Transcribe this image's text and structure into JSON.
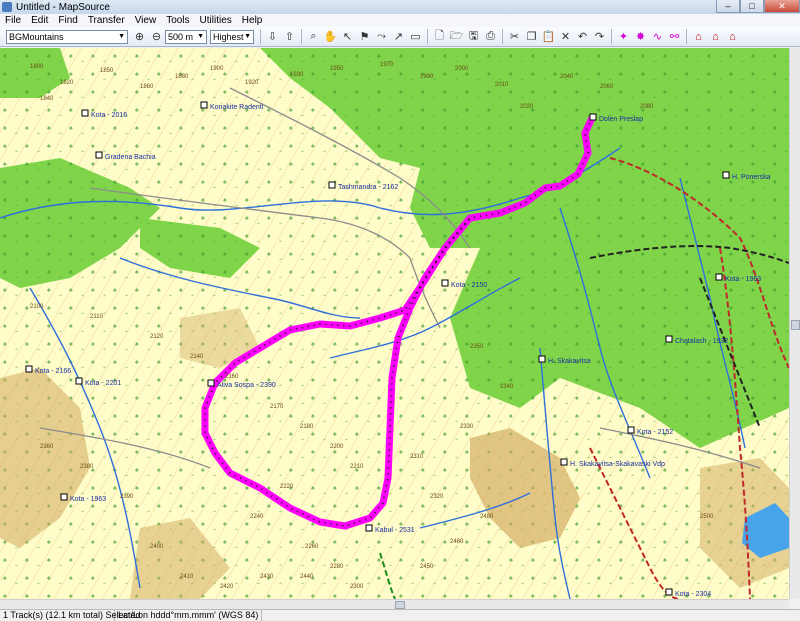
{
  "window": {
    "title": "Untitled - MapSource",
    "minimize": "–",
    "maximize": "□",
    "close": "✕"
  },
  "menu": [
    "File",
    "Edit",
    "Find",
    "Transfer",
    "View",
    "Tools",
    "Utilities",
    "Help"
  ],
  "toolbar": {
    "product": "BGMountains",
    "zoom": "500 m",
    "detail": "Highest"
  },
  "map": {
    "places": [
      {
        "label": "Kota - 2016"
      },
      {
        "label": "Koriakite Radenti"
      },
      {
        "label": "Gradena Bachia"
      },
      {
        "label": "Tashmandra - 2162"
      },
      {
        "label": "Kota - 2150"
      },
      {
        "label": "Aliva Sospa - 2390"
      },
      {
        "label": "Kabul - 2531"
      },
      {
        "label": "Kota - 2166"
      },
      {
        "label": "Kota - 2201"
      },
      {
        "label": "Kota - 1963"
      },
      {
        "label": "H. Skakavitsa"
      },
      {
        "label": "Chatalash - 1932"
      },
      {
        "label": "Kota - 2152"
      },
      {
        "label": "H. Skakavitsa-Skakavaski Vdp"
      },
      {
        "label": "Kota - 2304"
      },
      {
        "label": "H. Ponerska"
      },
      {
        "label": "Kota - 1963"
      },
      {
        "label": "Dolen Preslap"
      }
    ],
    "elevations": [
      "1800",
      "1820",
      "1840",
      "1850",
      "1860",
      "1880",
      "1900",
      "1920",
      "1930",
      "1950",
      "1970",
      "1990",
      "2000",
      "2010",
      "2020",
      "2040",
      "2060",
      "2080",
      "2100",
      "2110",
      "2120",
      "2140",
      "2160",
      "2170",
      "2180",
      "2200",
      "2210",
      "2220",
      "2240",
      "2260",
      "2280",
      "2300",
      "2310",
      "2320",
      "2330",
      "2340",
      "2350",
      "2360",
      "2380",
      "2390",
      "2400",
      "2410",
      "2420",
      "2430",
      "2440",
      "2450",
      "2460",
      "2480",
      "2500"
    ],
    "colors": {
      "track": "#ff00ff",
      "forest": "#7fd44a",
      "terrain": "#fefcc8",
      "water": "#2f6fdc",
      "road": "#8c8c8c"
    }
  },
  "status": {
    "selection": "1 Track(s) (12.1 km total) Selected",
    "coords": "Lat/Lon hddd°mm.mmm' (WGS 84)"
  }
}
